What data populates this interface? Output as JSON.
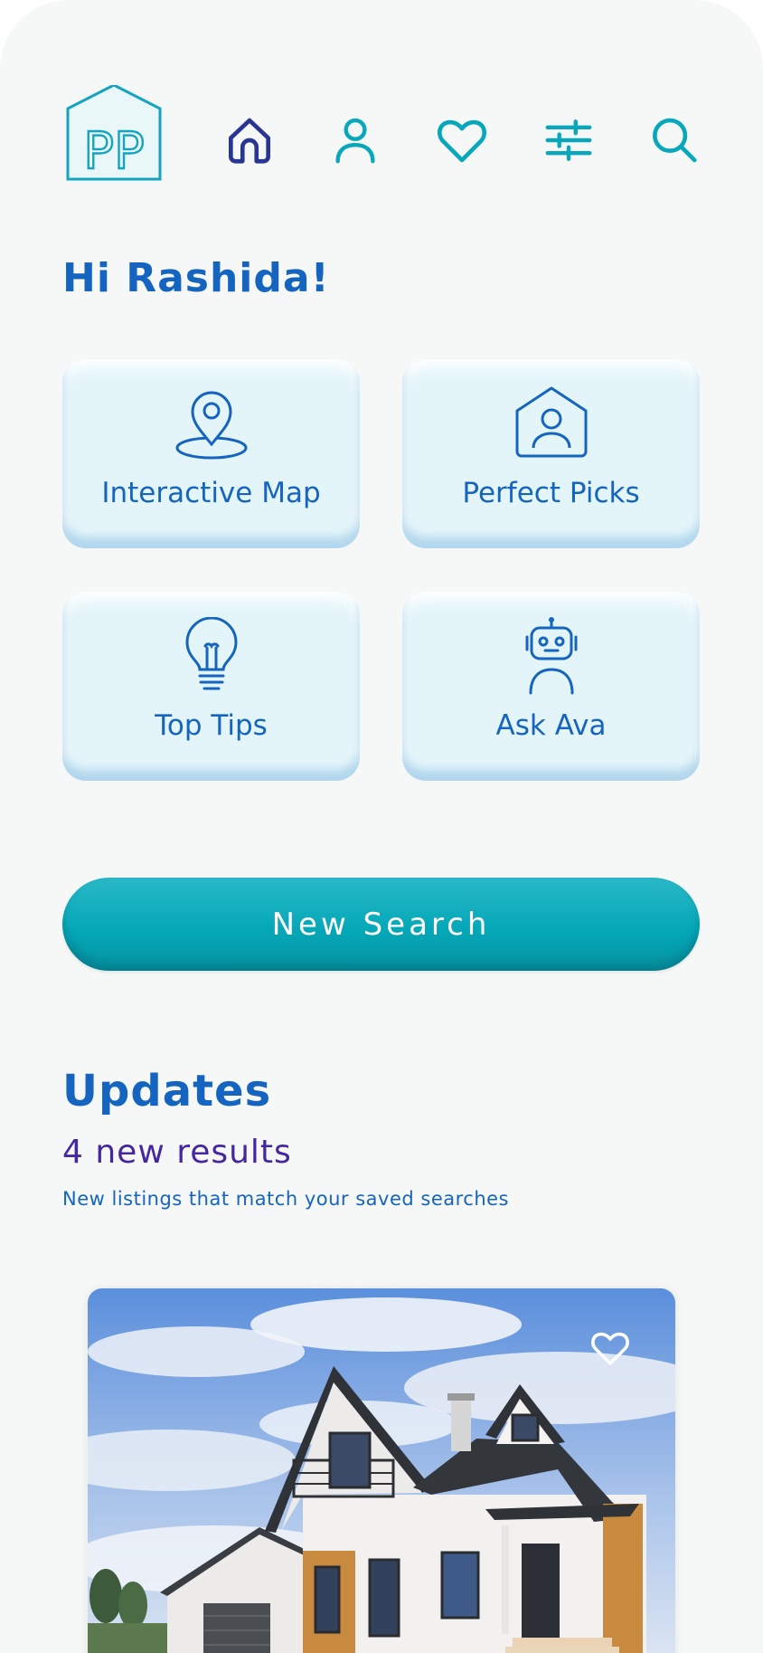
{
  "app": {
    "logo_text": "PP",
    "accent_color": "#05a8b8",
    "brand_blue": "#1565c0"
  },
  "nav": {
    "items": [
      {
        "name": "home",
        "icon": "home-icon",
        "active": true
      },
      {
        "name": "profile",
        "icon": "user-icon",
        "active": false
      },
      {
        "name": "favorites",
        "icon": "heart-icon",
        "active": false
      },
      {
        "name": "filters",
        "icon": "sliders-icon",
        "active": false
      },
      {
        "name": "search",
        "icon": "search-icon",
        "active": false
      }
    ]
  },
  "greeting": "Hi Rashida!",
  "tiles": [
    {
      "label": "Interactive Map",
      "icon": "map-pin-icon"
    },
    {
      "label": "Perfect Picks",
      "icon": "house-user-icon"
    },
    {
      "label": "Top Tips",
      "icon": "lightbulb-icon"
    },
    {
      "label": "Ask Ava",
      "icon": "robot-icon"
    }
  ],
  "new_search_label": "New Search",
  "updates": {
    "title": "Updates",
    "count_text": "4 new results",
    "description": "New listings that match your saved searches"
  },
  "listing": {
    "favorite_icon": "heart-outline-icon"
  }
}
